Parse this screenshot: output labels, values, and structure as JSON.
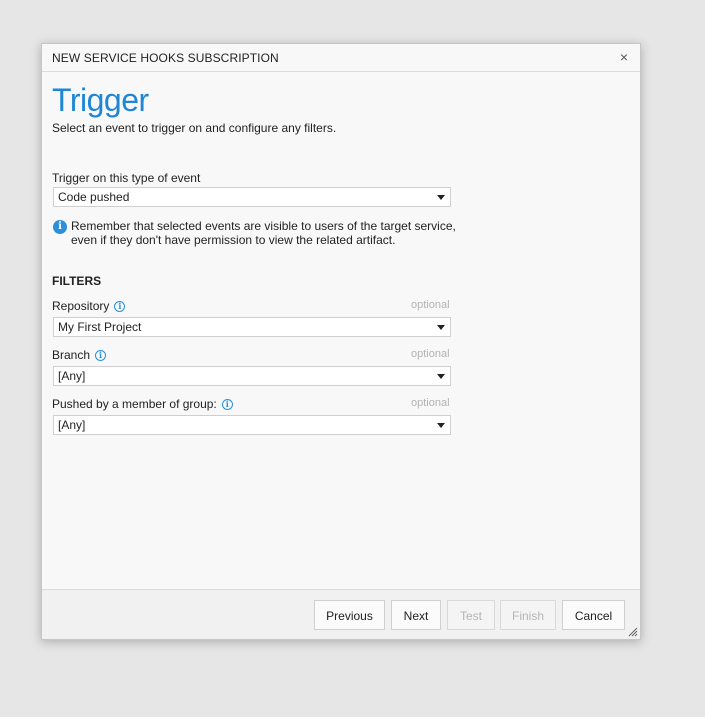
{
  "dialog": {
    "title": "NEW SERVICE HOOKS SUBSCRIPTION",
    "close_glyph": "×"
  },
  "page": {
    "heading": "Trigger",
    "subtitle": "Select an event to trigger on and configure any filters."
  },
  "trigger": {
    "label": "Trigger on this type of event",
    "value": "Code pushed"
  },
  "notice": {
    "text": "Remember that selected events are visible to users of the target service, even if they don't have permission to view the related artifact."
  },
  "filters": {
    "title": "FILTERS",
    "optional_text": "optional",
    "repository": {
      "label": "Repository",
      "value": "My First Project"
    },
    "branch": {
      "label": "Branch",
      "value": "[Any]"
    },
    "pushed_by": {
      "label": "Pushed by a member of group:",
      "value": "[Any]"
    }
  },
  "footer": {
    "previous_label": "Previous",
    "next_label": "Next",
    "test_label": "Test",
    "finish_label": "Finish",
    "cancel_label": "Cancel"
  },
  "icons": {
    "info": "info-icon",
    "close": "close-icon",
    "dropdown": "chevron-down-icon",
    "resize": "resize-grip-icon"
  },
  "colors": {
    "accent": "#1e86d6",
    "info": "#2b8fd9",
    "optional_text": "#b3b3b3"
  }
}
